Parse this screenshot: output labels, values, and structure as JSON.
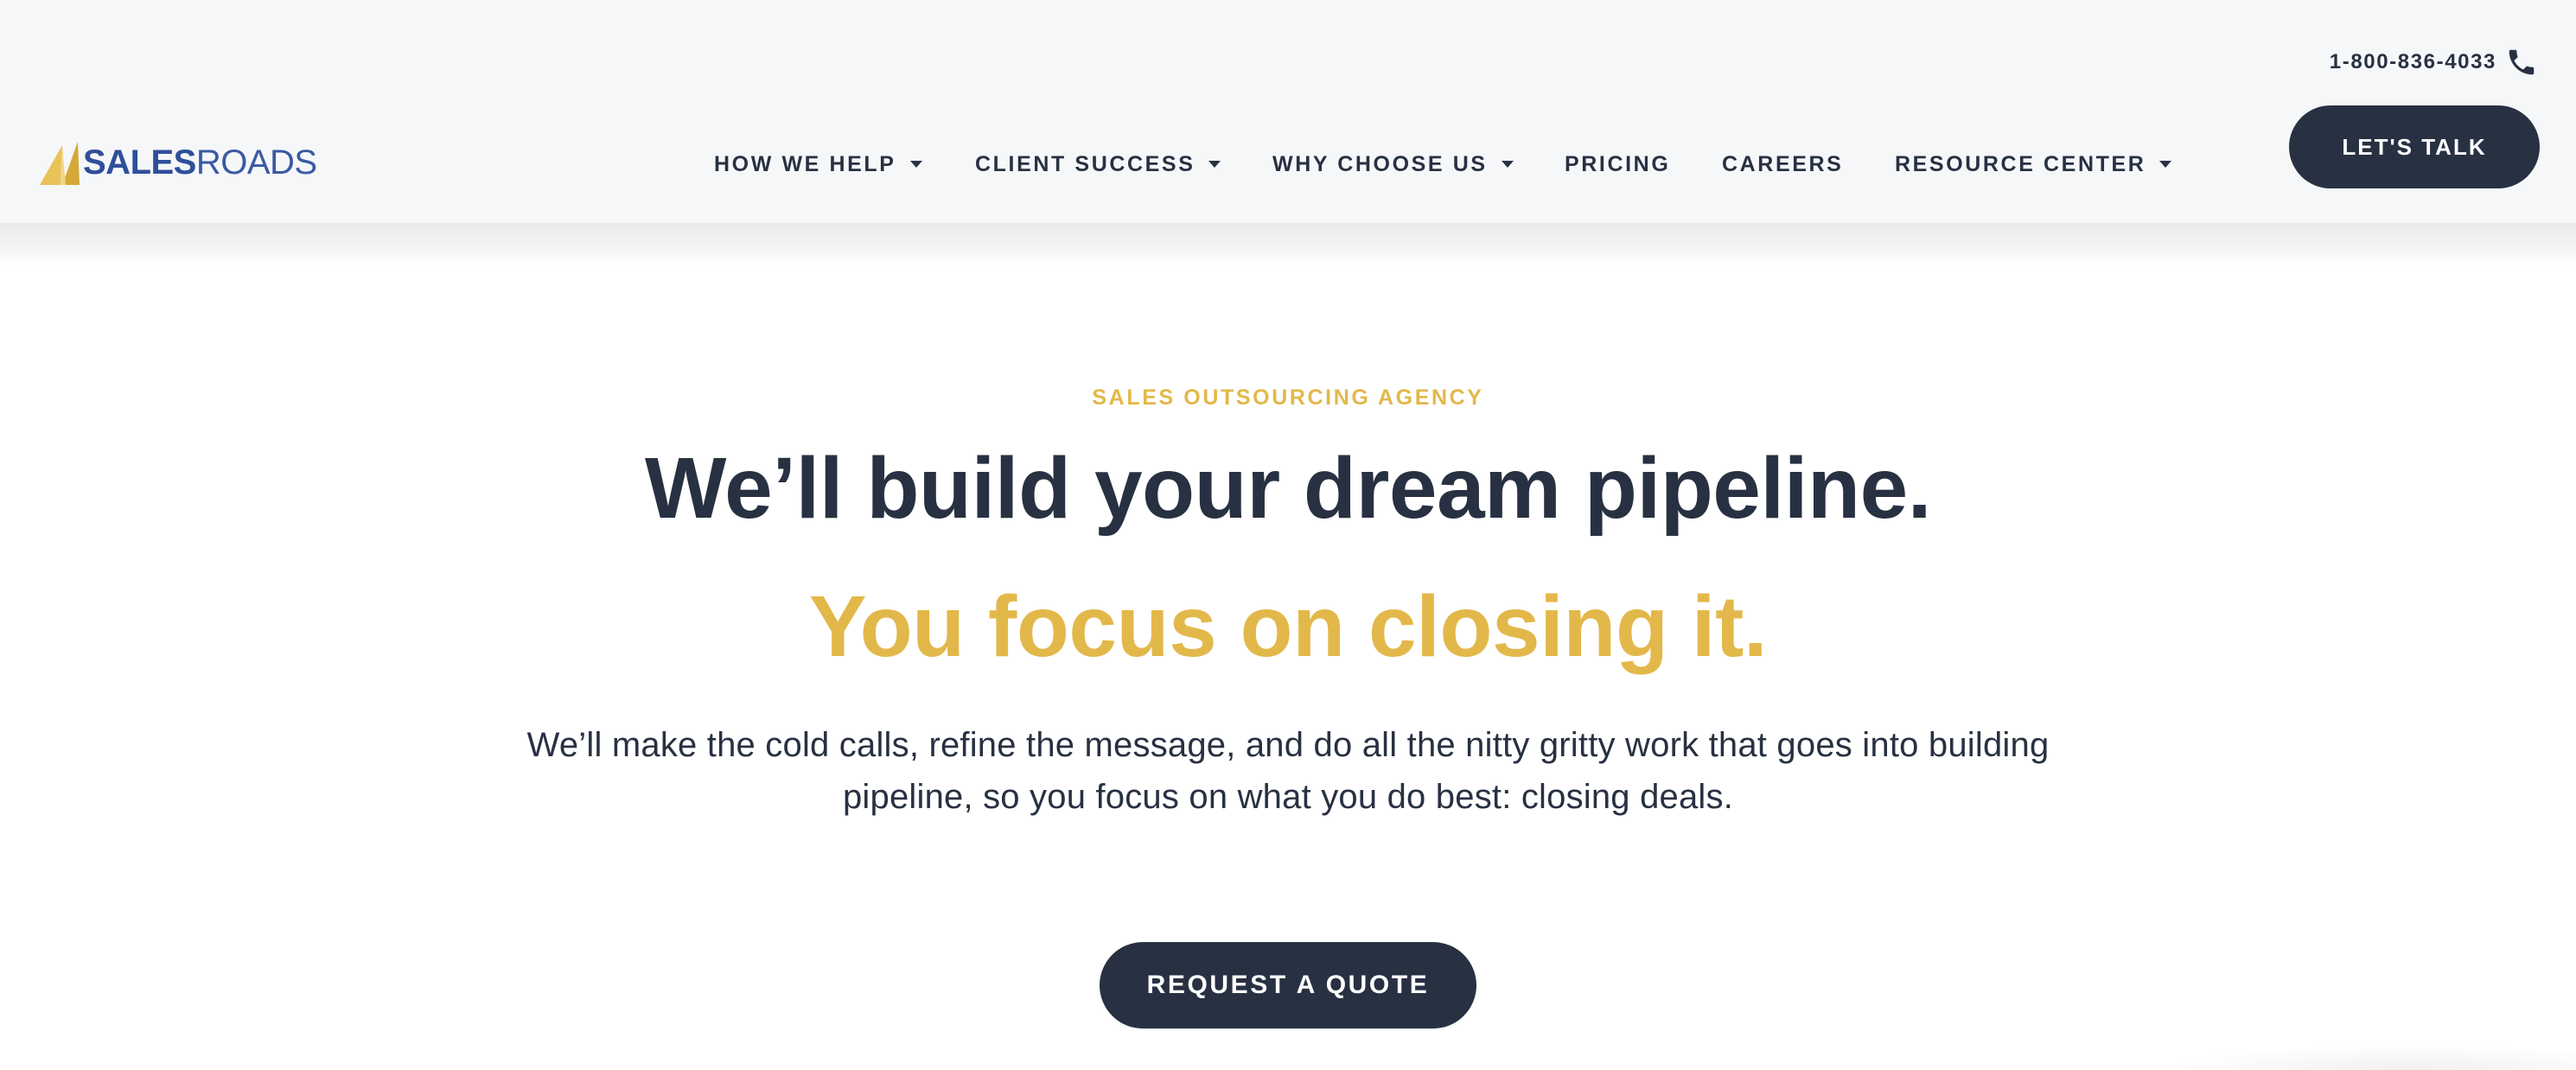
{
  "colors": {
    "navy": "#283142",
    "gold": "#e3b84a",
    "header_bg": "#f6f7f9",
    "logo_blue": "#2f4f9a"
  },
  "logo": {
    "sales": "SALES",
    "roads": "ROADS",
    "icon": "sail-icon"
  },
  "contact": {
    "phone": "1-800-836-4033",
    "icon": "phone-icon"
  },
  "nav": {
    "items": [
      {
        "label": "HOW WE HELP",
        "has_dropdown": true
      },
      {
        "label": "CLIENT SUCCESS",
        "has_dropdown": true
      },
      {
        "label": "WHY CHOOSE US",
        "has_dropdown": true
      },
      {
        "label": "PRICING",
        "has_dropdown": false
      },
      {
        "label": "CAREERS",
        "has_dropdown": false
      },
      {
        "label": "RESOURCE CENTER",
        "has_dropdown": true
      }
    ]
  },
  "header_cta": {
    "label": "LET'S TALK"
  },
  "hero": {
    "eyebrow": "SALES OUTSOURCING AGENCY",
    "headline": "We’ll build your dream pipeline.",
    "subhead": "You focus on closing it.",
    "lede": "We’ll make the cold calls, refine the message, and do all the nitty gritty work that goes into building pipeline, so you focus on what you do best: closing deals.",
    "cta": "REQUEST A QUOTE"
  }
}
